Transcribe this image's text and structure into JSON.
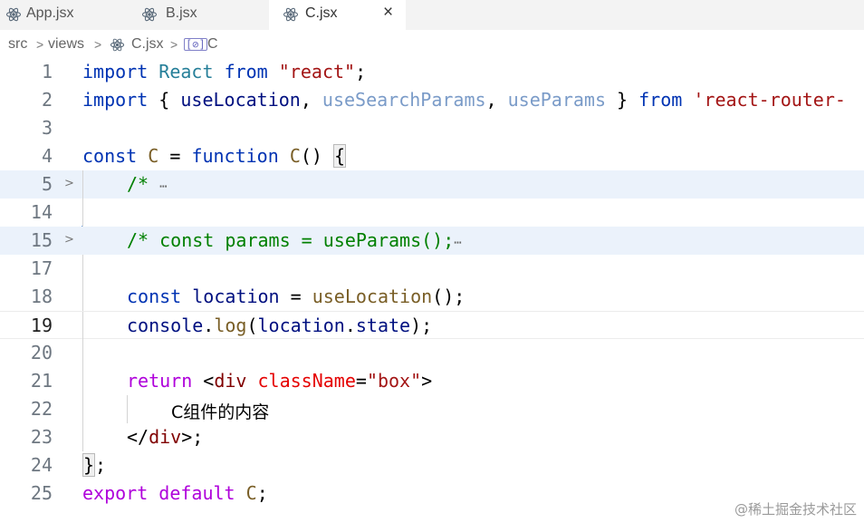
{
  "tabs": [
    {
      "label": "App.jsx"
    },
    {
      "label": "B.jsx"
    },
    {
      "label": "C.jsx",
      "close": "×"
    }
  ],
  "breadcrumb": {
    "parts": [
      "src",
      "views",
      "C.jsx",
      "C"
    ],
    "separator": ">"
  },
  "editor": {
    "lines": [
      {
        "n": "1",
        "t": [
          "import",
          " ",
          "React",
          " ",
          "from",
          " ",
          "\"react\"",
          ";"
        ]
      },
      {
        "n": "2",
        "t": [
          "import",
          " { ",
          "useLocation",
          ", ",
          "useSearchParams",
          ", ",
          "useParams",
          " } ",
          "from",
          " ",
          "'react-router-"
        ]
      },
      {
        "n": "3"
      },
      {
        "n": "4",
        "t": [
          "const",
          " ",
          "C",
          " = ",
          "function",
          " ",
          "C",
          "() ",
          "{"
        ]
      },
      {
        "n": "5",
        "fold": ">",
        "t": [
          "/* ",
          "⋯"
        ]
      },
      {
        "n": "14"
      },
      {
        "n": "15",
        "fold": ">",
        "t": [
          "/* const params = useParams();",
          "⋯"
        ]
      },
      {
        "n": "17"
      },
      {
        "n": "18",
        "t": [
          "const",
          " ",
          "location",
          " = ",
          "useLocation",
          "();"
        ]
      },
      {
        "n": "19",
        "t": [
          "console",
          ".",
          "log",
          "(",
          "location",
          ".",
          "state",
          ");"
        ]
      },
      {
        "n": "20"
      },
      {
        "n": "21",
        "t": [
          "return",
          " <",
          "div",
          " ",
          "className",
          "=",
          "\"box\"",
          ">"
        ]
      },
      {
        "n": "22",
        "t": [
          "C组件的内容"
        ]
      },
      {
        "n": "23",
        "t": [
          "</",
          "div",
          ">;"
        ]
      },
      {
        "n": "24",
        "t": [
          "}",
          ";"
        ]
      },
      {
        "n": "25",
        "t": [
          "export",
          " ",
          "default",
          " ",
          "C",
          ";"
        ]
      }
    ]
  },
  "watermark": "@稀土掘金技术社区",
  "colors": {
    "keyword": "#0033b3",
    "string": "#a31515",
    "function": "#795e26",
    "variable": "#001080",
    "comment": "#008000",
    "fold_highlight": "#ebf2fb"
  },
  "icons": {
    "tab_icon": "react-icon",
    "symbol_icon": "symbol-method-icon",
    "fold_icon": "chevron-right-icon"
  }
}
